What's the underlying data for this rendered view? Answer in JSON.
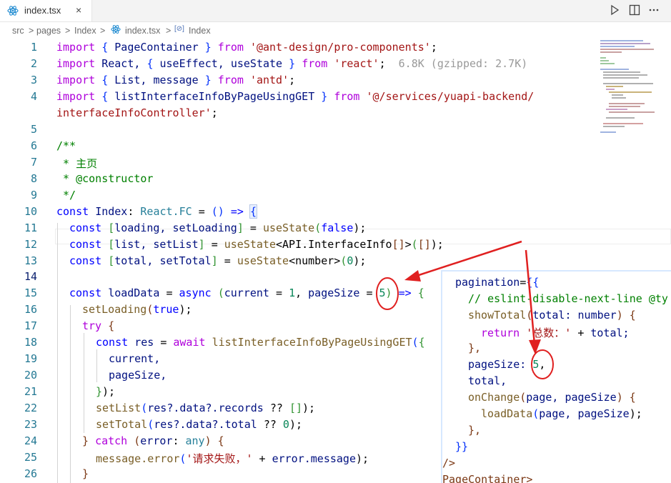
{
  "tab": {
    "filename": "index.tsx",
    "close_glyph": "×"
  },
  "breadcrumb": {
    "items": [
      "src",
      "pages",
      "Index",
      "index.tsx",
      "Index"
    ],
    "separator": ">"
  },
  "line_numbers": [
    "1",
    "2",
    "3",
    "4",
    "5",
    "6",
    "7",
    "8",
    "9",
    "10",
    "11",
    "12",
    "13",
    "14",
    "15",
    "16",
    "17",
    "18",
    "19",
    "20",
    "21",
    "22",
    "23",
    "24",
    "25",
    "26"
  ],
  "code": {
    "l1": [
      "import",
      "{",
      "PageContainer",
      "}",
      "from",
      "'@ant-design/pro-components'",
      ";"
    ],
    "l2": [
      "import",
      "React,",
      "{",
      "useEffect,",
      "useState",
      "}",
      "from",
      "'react'",
      ";",
      "6.8K (gzipped: 2.7K)"
    ],
    "l3": [
      "import",
      "{",
      "List,",
      "message",
      "}",
      "from",
      "'antd'",
      ";"
    ],
    "l4a": [
      "import",
      "{",
      "listInterfaceInfoByPageUsingGET",
      "}",
      "from",
      "'@/services/yuapi-backend/"
    ],
    "l4b": [
      "interfaceInfoController'",
      ";"
    ],
    "l6": "/**",
    "l7": " * 主页",
    "l8": " * @constructor",
    "l9": " */",
    "l10": [
      "const",
      "Index",
      ":",
      "React.FC",
      "=",
      "()",
      "=>",
      "{"
    ],
    "l11": [
      "const",
      "[",
      "loading,",
      "setLoading",
      "]",
      "=",
      "useState",
      "(",
      "false",
      ");"
    ],
    "l12": [
      "const",
      "[",
      "list,",
      "setList",
      "]",
      "=",
      "useState",
      "<API.InterfaceInfo",
      "[]",
      ">",
      "(",
      "[]",
      ");"
    ],
    "l13": [
      "const",
      "[",
      "total,",
      "setTotal",
      "]",
      "=",
      "useState",
      "<number>",
      "(",
      "0",
      ");"
    ],
    "l15": [
      "const",
      "loadData",
      "=",
      "async",
      "(",
      "current",
      "=",
      "1",
      ",",
      "pageSize",
      "=",
      "5",
      ")",
      "=>",
      "{"
    ],
    "l16": [
      "setLoading",
      "(",
      "true",
      ");"
    ],
    "l17": [
      "try",
      "{"
    ],
    "l18": [
      "const",
      "res",
      "=",
      "await",
      "listInterfaceInfoByPageUsingGET",
      "(",
      "{"
    ],
    "l19": "current,",
    "l20": "pageSize,",
    "l21": [
      "}",
      ");"
    ],
    "l22": [
      "setList",
      "(",
      "res?.data?.records",
      "??",
      "[]",
      ");"
    ],
    "l23": [
      "setTotal",
      "(",
      "res?.data?.total",
      "??",
      "0",
      ");"
    ],
    "l24": [
      "}",
      "catch",
      "(",
      "error",
      ":",
      "any",
      ")",
      "{"
    ],
    "l25": [
      "message.error",
      "(",
      "'请求失败，'",
      "+",
      "error.message",
      ");"
    ],
    "l26": "}"
  },
  "overlay": {
    "lines": [
      [
        "pagination",
        "=",
        "{{"
      ],
      [
        "// eslint-disable-next-line @ty"
      ],
      [
        "showTotal",
        "(",
        "total: number",
        ")",
        "{"
      ],
      [
        "return",
        "'总数：'",
        "+",
        "total;"
      ],
      [
        "},"
      ],
      [
        "pageSize:",
        "5",
        ","
      ],
      [
        "total,"
      ],
      [
        "onChange",
        "(",
        "page, pageSize",
        ")",
        "{"
      ],
      [
        "loadData",
        "(",
        "page, pageSize",
        ");"
      ],
      [
        "},"
      ],
      [
        "}}"
      ],
      [
        "/>"
      ],
      [
        "PageContainer>"
      ]
    ]
  },
  "colors": {
    "keyword": "#0000ff",
    "control": "#af00db",
    "string": "#a31515",
    "comment": "#008000",
    "type": "#267f99",
    "function": "#795e26",
    "number": "#098658",
    "line_number": "#237893",
    "annotation_red": "#e02020"
  },
  "icons": [
    "react-icon",
    "run-icon",
    "split-editor-icon",
    "more-icon",
    "symbol-icon"
  ]
}
